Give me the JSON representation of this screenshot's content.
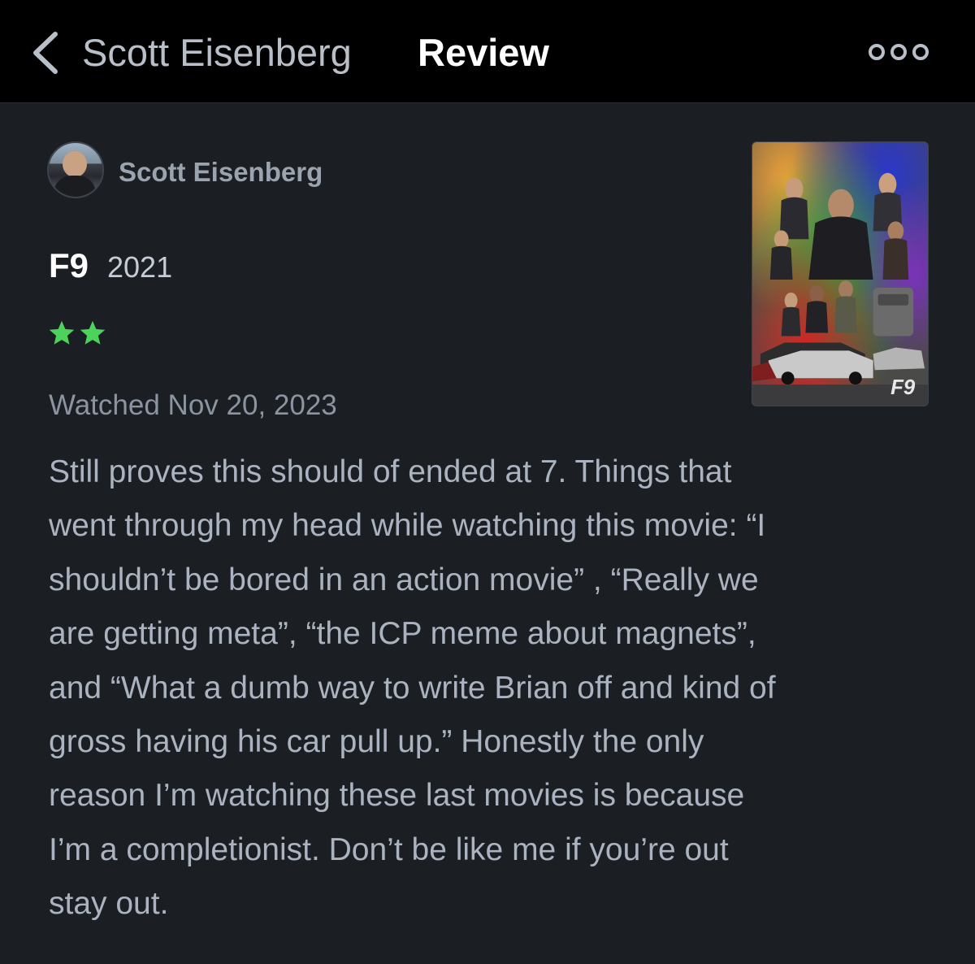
{
  "header": {
    "back_label": "Scott Eisenberg",
    "title": "Review",
    "more_icon": "more-options-icon"
  },
  "review": {
    "author": "Scott Eisenberg",
    "film_title": "F9",
    "film_year": "2021",
    "rating_stars": 2,
    "rating_color": "#4bd35c",
    "watched": "Watched Nov 20, 2023",
    "poster_label": "F9",
    "body_lines": [
      "Still proves this should of ended at 7. Things that",
      "went through my head while watching this movie: “I",
      "shouldn’t be bored in an action movie” , “Really we",
      "are getting meta”, “the ICP meme about magnets”,",
      "and “What a dumb way to write Brian off and kind of",
      "gross having his car pull up.” Honestly the only",
      "reason I’m watching these last movies is because",
      "I’m a completionist. Don’t be like me if you’re out",
      "stay out."
    ]
  },
  "colors": {
    "background": "#1b1e23",
    "header_background": "#000000",
    "accent_green": "#4bd35c"
  }
}
